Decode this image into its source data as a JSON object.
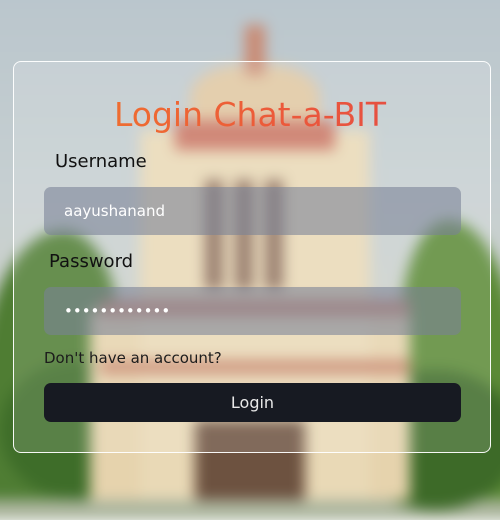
{
  "login_form": {
    "title": "Login Chat-a-BIT",
    "username_label": "Username",
    "username_value": "aayushanand",
    "password_label": "Password",
    "password_value": "************",
    "signup_link": "Don't have an account?",
    "login_button": "Login"
  },
  "colors": {
    "title_gradient_start": "#f07a2a",
    "title_gradient_end": "#e04548",
    "button_background": "#171a22",
    "input_background": "rgba(120,130,150,0.58)"
  }
}
